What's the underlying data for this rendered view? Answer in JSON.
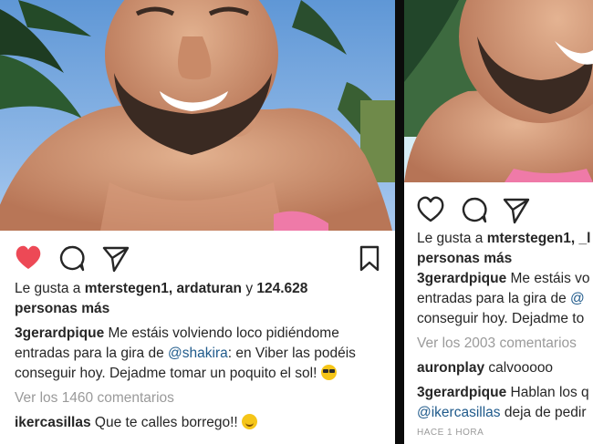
{
  "left_post": {
    "likes": {
      "prefix": "Le gusta a",
      "users": "mterstegen1, ardaturan",
      "conjunction": "y",
      "count": "124.628",
      "suffix": "personas más"
    },
    "caption": {
      "username": "3gerardpique",
      "line1": "Me estáis volviendo loco pidiéndome",
      "line2_start": "entradas para la gira de",
      "mention": "@shakira",
      "line2_end": ": en Viber las podéis",
      "line3": "conseguir hoy. Dejadme tomar un poquito el sol!"
    },
    "view_comments": "Ver los 1460 comentarios",
    "comment": {
      "username": "ikercasillas",
      "text": "Que te calles borrego!!"
    },
    "liked": true
  },
  "right_post": {
    "likes": {
      "prefix": "Le gusta a",
      "users": "mterstegen1, _l",
      "suffix": "personas más"
    },
    "caption": {
      "username": "3gerardpique",
      "line1": "Me estáis vo",
      "line2_start": "entradas para la gira de",
      "mention_partial": "@",
      "line3": "conseguir hoy. Dejadme to"
    },
    "view_comments": "Ver los 2003 comentarios",
    "comment1": {
      "username": "auronplay",
      "text": "calvooooo"
    },
    "comment2": {
      "username": "3gerardpique",
      "text": "Hablan los q",
      "mention": "@ikercasillas",
      "rest": "deja de pedir"
    },
    "time_ago": "HACE 1 HORA"
  },
  "colors": {
    "heart_liked": "#ed4956",
    "mention": "#1f5a8b",
    "muted": "#9a9a9a",
    "text": "#262626"
  },
  "icons": [
    "heart-icon",
    "comment-icon",
    "share-icon",
    "bookmark-icon"
  ]
}
